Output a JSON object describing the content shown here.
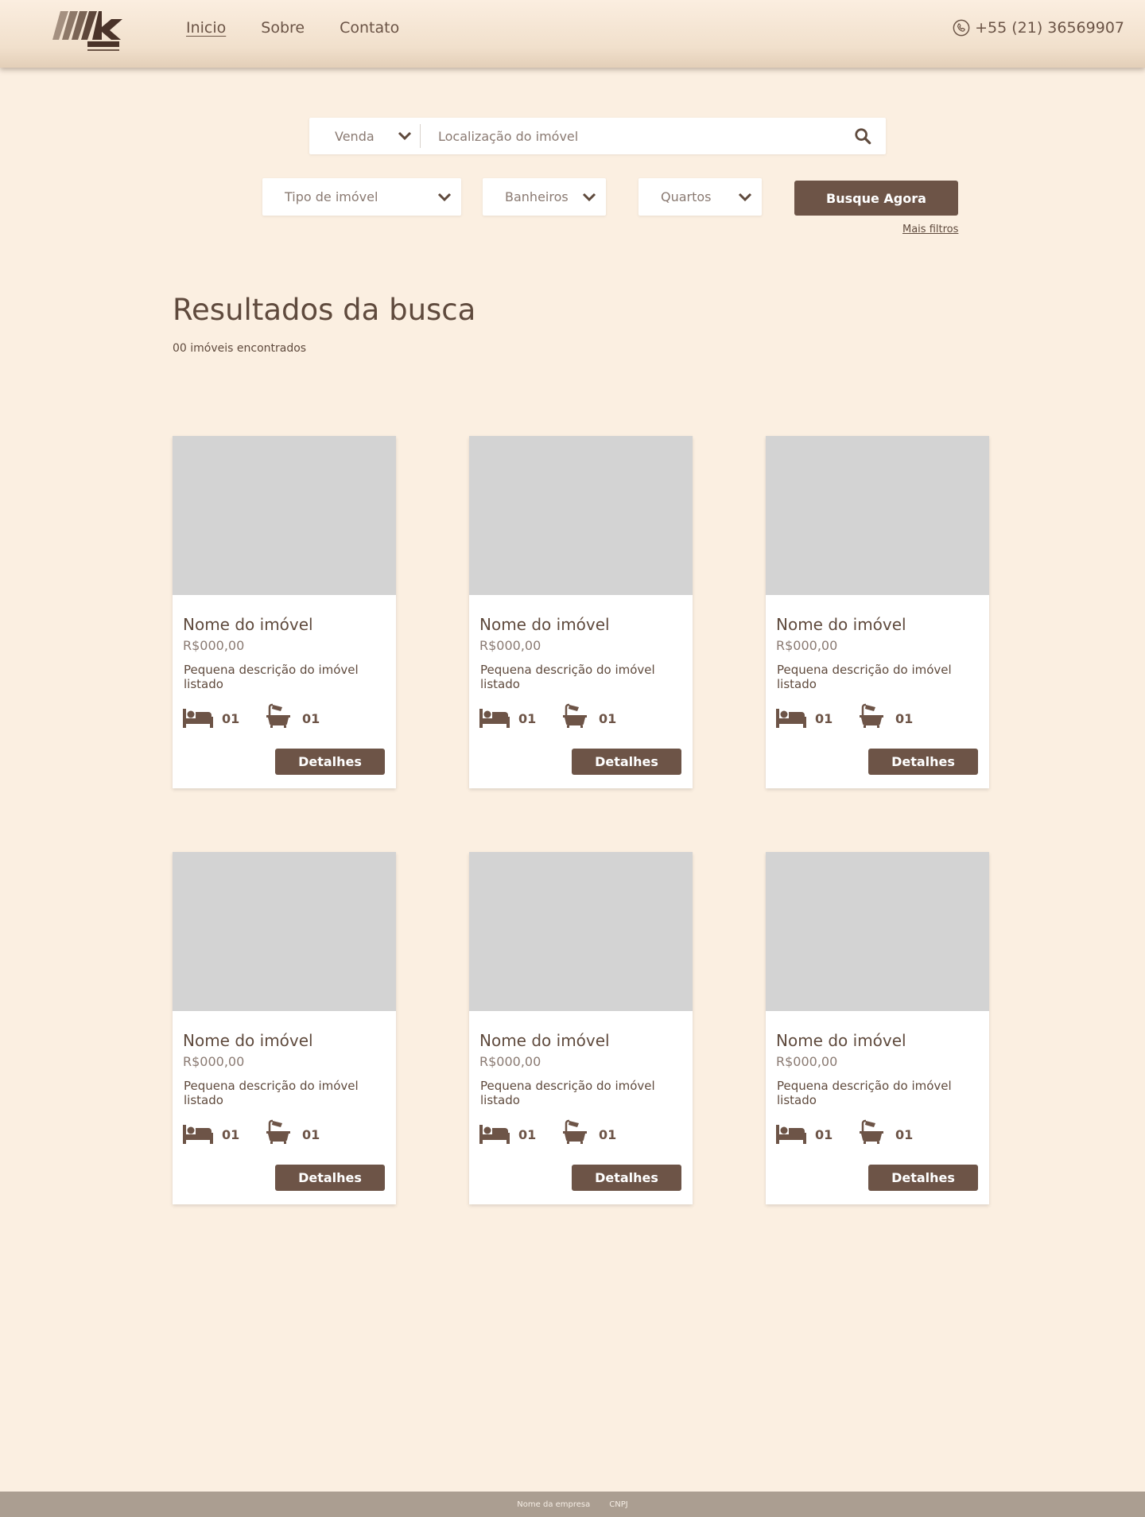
{
  "header": {
    "nav": [
      {
        "label": "Inicio",
        "active": true
      },
      {
        "label": "Sobre",
        "active": false
      },
      {
        "label": "Contato",
        "active": false
      }
    ],
    "phone": "+55 (21) 36569907",
    "phone_icon": "phone-icon"
  },
  "search": {
    "type_value": "Venda",
    "location_placeholder": "Localização do imóvel",
    "search_icon": "search-icon"
  },
  "filters": {
    "tipo": "Tipo de imóvel",
    "banheiros": "Banheiros",
    "quartos": "Quartos",
    "busque_label": "Busque Agora",
    "mais_filtros": "Mais filtros"
  },
  "results": {
    "title": "Resultados da busca",
    "count": "00 imóveis encontrados"
  },
  "cards": [
    {
      "name": "Nome do imóvel",
      "price": "R$000,00",
      "desc": "Pequena descrição do imóvel listado",
      "beds": "01",
      "baths": "01",
      "button": "Detalhes"
    },
    {
      "name": "Nome do imóvel",
      "price": "R$000,00",
      "desc": "Pequena descrição do imóvel listado",
      "beds": "01",
      "baths": "01",
      "button": "Detalhes"
    },
    {
      "name": "Nome do imóvel",
      "price": "R$000,00",
      "desc": "Pequena descrição do imóvel listado",
      "beds": "01",
      "baths": "01",
      "button": "Detalhes"
    },
    {
      "name": "Nome do imóvel",
      "price": "R$000,00",
      "desc": "Pequena descrição do imóvel listado",
      "beds": "01",
      "baths": "01",
      "button": "Detalhes"
    },
    {
      "name": "Nome do imóvel",
      "price": "R$000,00",
      "desc": "Pequena descrição do imóvel listado",
      "beds": "01",
      "baths": "01",
      "button": "Detalhes"
    },
    {
      "name": "Nome do imóvel",
      "price": "R$000,00",
      "desc": "Pequena descrição do imóvel listado",
      "beds": "01",
      "baths": "01",
      "button": "Detalhes"
    }
  ],
  "footer": {
    "company": "Nome da empresa",
    "cnpj": "CNPJ"
  },
  "colors": {
    "background": "#fbefe1",
    "accent": "#6d5447",
    "text": "#5f4a3d",
    "placeholder_image": "#d3d3d3",
    "footer": "#ab9e91"
  }
}
